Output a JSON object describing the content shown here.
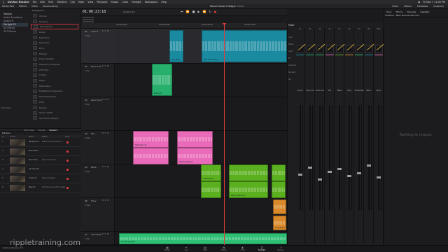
{
  "menubar": {
    "app": "DaVinci Resolve",
    "items": [
      "File",
      "Edit",
      "Trim",
      "Timeline",
      "Clip",
      "Mark",
      "View",
      "Playback",
      "Fusion",
      "Color",
      "Fairlight",
      "Workspace",
      "Help"
    ],
    "clock": "Fri Nov 7 12:40 PM"
  },
  "toolbar": {
    "left": [
      "Media Pool",
      "Effects",
      "Index",
      "Sound Library"
    ],
    "title": "Nelson Fasser-2 Stages",
    "title_suffix": "Edited",
    "right": [
      "Mixer",
      "Meters",
      "Metadata",
      "Inspector"
    ]
  },
  "left_panel": {
    "bins": [
      {
        "label": "Toolbox",
        "selected": false
      },
      {
        "label": "Audio Transitions",
        "selected": false
      },
      {
        "label": "Audio FX",
        "selected": false
      },
      {
        "label": "Fairlight FX",
        "selected": true
      },
      {
        "label": "AU Effects",
        "selected": false
      },
      {
        "label": "VST Effects",
        "selected": false
      }
    ],
    "fx_header": "Fairlight FX",
    "fx": [
      "Chorus",
      "De-Esser",
      "De-Hummer",
      "Delay",
      "Distortion",
      "Dynamics",
      "Echo",
      "Flanger",
      "Foley Sampler",
      "Frequency Analyzer",
      "LFE Filter",
      "Limiter",
      "Meter",
      "Modulation",
      "Multiband Compressor",
      "Noise Reduction",
      "Pitch",
      "Reverb",
      "Stereo Width",
      "Surround Analyzer"
    ],
    "selected_fx": 2,
    "favorites_label": "Favorites"
  },
  "left_tabs": {
    "items": [
      "Edit Index",
      "Tracks",
      "Markers"
    ],
    "active": 2
  },
  "markers": {
    "title": "Markers",
    "columns": [
      "#",
      "Frame",
      "Name",
      "Notes",
      "Color"
    ],
    "rows": [
      {
        "num": "1",
        "name": "Background",
        "note": "Starts mid-way fade in"
      },
      {
        "num": "2",
        "name": "Main Music",
        "note": ""
      },
      {
        "num": "3",
        "name": "Bus Fmr's",
        "note": "Use over music"
      },
      {
        "num": "4",
        "name": "Car Sounds",
        "note": ""
      },
      {
        "num": "5",
        "name": "Crowd fx",
        "note": "Scene overlap"
      },
      {
        "num": "6",
        "name": "New Fx",
        "note": "Good fine sound for segment"
      }
    ]
  },
  "timeline": {
    "timecode": "01:00:23:18",
    "name": "Custom 23",
    "timecodes_left": [
      "01:00:23:18",
      "01:00:00:00",
      "00:00:00:00"
    ],
    "ruler": [
      "01:00:00:00",
      "01:00:08:00",
      "01:00:16:00",
      "01:00:24:00",
      "01:00:32:00"
    ],
    "tracks": [
      {
        "id": "A1",
        "name": "Audio 1",
        "clips": "2 Clips"
      },
      {
        "id": "A2",
        "name": "Music Cue",
        "clips": "1 Clip"
      },
      {
        "id": "A3",
        "name": "Room Tone",
        "clips": "0 Clip"
      },
      {
        "id": "A4",
        "name": "SFX",
        "clips": "4 Clips"
      },
      {
        "id": "A5",
        "name": "BKGS",
        "clips": "8 Clips"
      },
      {
        "id": "A6",
        "name": "Foley",
        "clips": "2 Clips"
      },
      {
        "id": "A7",
        "name": "Soundscape",
        "clips": "1 Clip"
      }
    ],
    "clip_labels": [
      "Main_Take_1",
      "Main Nuendo Mix_1",
      "Dialog_03",
      "Hosts Voice_01",
      "Cheers_Ambience",
      "Creeks_Wood",
      "Mesh ambience_01",
      "Gang Boards",
      "Soundscape_Wide"
    ]
  },
  "mixer": {
    "title": "Mixer",
    "row_labels": [
      "Input",
      "Effects",
      "Insert",
      "EQ",
      "Dynamics",
      "Bus Send",
      "Pan"
    ],
    "strips": [
      "A1",
      "A2",
      "A3",
      "A4",
      "A5",
      "A6",
      "A7",
      "M1",
      "Bus1"
    ],
    "strip_names": [
      "Audio 1",
      "Music Cue",
      "Room Tone",
      "SFX",
      "BKGS",
      "Foley",
      "Soundscape",
      "Main 1",
      "Bus 1"
    ]
  },
  "right_panel": {
    "tabs": [
      "Mixer",
      "Effects",
      "Metadata",
      "Inspector"
    ],
    "title": "Timeline - Main Nuendo Mix.mov",
    "empty": "Nothing to inspect"
  },
  "pagebar": {
    "pages": [
      "Media",
      "Cut",
      "Edit",
      "Fusion",
      "Color",
      "Fairlight",
      "Deliver"
    ],
    "active": 5,
    "brand": "DaVinci Resolve 18",
    "watermark": "rippletraining.com"
  },
  "colors": {
    "a1": "#1a8aa0",
    "a2": "#27b06c",
    "a4": "#e96ab8",
    "a5": "#5bb01f",
    "a6": "#d9892a",
    "a7": "#2fbf74",
    "playhead": "#e23b3b"
  }
}
